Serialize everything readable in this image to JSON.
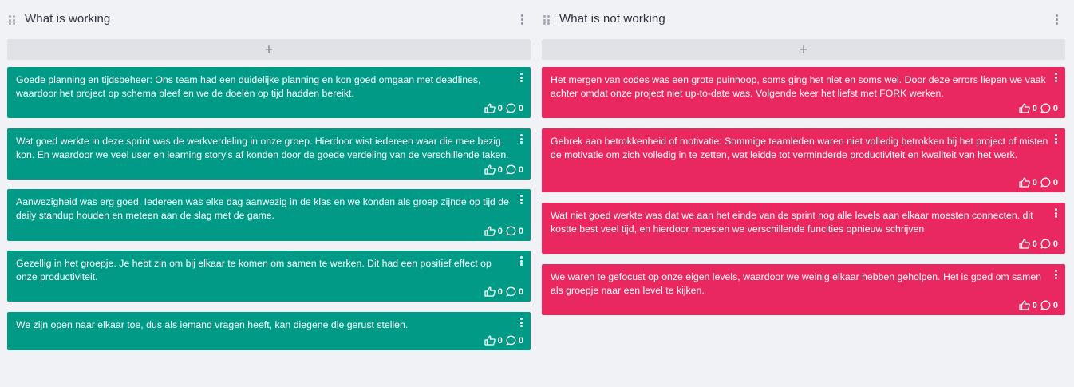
{
  "columns": [
    {
      "title": "What is working",
      "add_label": "+",
      "cards": [
        {
          "text": "Goede planning en tijdsbeheer: Ons team had een duidelijke planning en kon goed omgaan met deadlines, waardoor het project op schema bleef en we de doelen op tijd hadden bereikt.",
          "likes": "0",
          "comments": "0"
        },
        {
          "text": "Wat goed werkte in deze sprint was de werkverdeling in onze groep. Hierdoor wist iedereen waar die mee bezig kon. En waardoor we veel user en learning story's af konden door de goede verdeling van de verschillende taken.",
          "likes": "0",
          "comments": "0"
        },
        {
          "text": "Aanwezigheid was erg goed. Iedereen was elke dag aanwezig in de klas en we konden als groep zijnde op tijd de daily standup houden en meteen aan de slag met de game.",
          "likes": "0",
          "comments": "0"
        },
        {
          "text": "Gezellig in het groepje. Je hebt zin om bij elkaar te komen om samen te werken. Dit had een positief effect op onze productiviteit.",
          "likes": "0",
          "comments": "0"
        },
        {
          "text": "We zijn open naar elkaar toe, dus als iemand vragen heeft, kan diegene die gerust stellen.",
          "likes": "0",
          "comments": "0"
        }
      ]
    },
    {
      "title": "What is not working",
      "add_label": "+",
      "cards": [
        {
          "text": "Het mergen van codes was een grote puinhoop, soms ging het niet en soms wel. Door deze errors liepen we vaak achter omdat onze project niet up-to-date was. Volgende keer het liefst met FORK werken.",
          "likes": "0",
          "comments": "0"
        },
        {
          "text": "Gebrek aan betrokkenheid of motivatie: Sommige teamleden waren niet volledig betrokken bij het project of misten de motivatie om zich volledig in te zetten, wat leidde tot verminderde productiviteit en kwaliteit van het werk.",
          "likes": "0",
          "comments": "0"
        },
        {
          "text": "Wat niet goed werkte was dat we aan het einde van de sprint nog alle levels aan elkaar moesten connecten. dit kostte best veel tijd, en hierdoor moesten we verschillende funcities opnieuw schrijven",
          "likes": "0",
          "comments": "0"
        },
        {
          "text": "We waren te gefocust op onze eigen levels, waardoor we weinig elkaar hebben geholpen. Het is goed om samen als groepje naar een level te kijken.",
          "likes": "0",
          "comments": "0"
        }
      ]
    }
  ],
  "colors": {
    "working": "#009a87",
    "not_working": "#e9285f",
    "background": "#f1f2f6"
  },
  "icons": {
    "drag": "drag-handle-icon",
    "menu": "kebab-menu-icon",
    "like": "thumbs-up-icon",
    "comment": "comment-bubble-icon"
  }
}
